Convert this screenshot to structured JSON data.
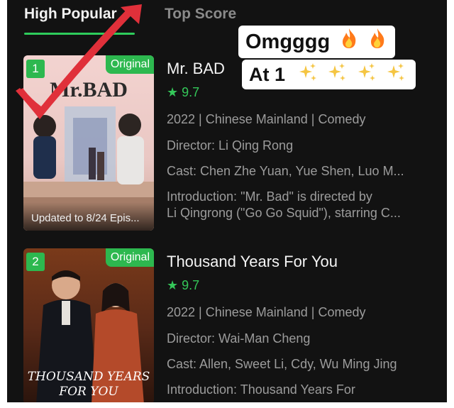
{
  "tabs": [
    {
      "label": "High Popular"
    },
    {
      "label": "Top Score"
    }
  ],
  "items": [
    {
      "rank": "1",
      "badge": "Original",
      "title": "Mr. BAD",
      "poster_text": "Mr.BAD",
      "rating": "9.7",
      "meta": "2022 | Chinese Mainland | Comedy",
      "director": "Director: Li Qing Rong",
      "cast": "Cast: Chen Zhe Yuan, Yue Shen, Luo M...",
      "intro_line1": "Introduction: \"Mr. Bad\" is directed by",
      "intro_line2": "Li Qingrong (\"Go Go Squid\"), starring C...",
      "update": "Updated to 8/24 Epis..."
    },
    {
      "rank": "2",
      "badge": "Original",
      "title": "Thousand Years For You",
      "poster_text_line1": "THOUSAND YEARS",
      "poster_text_line2": "FOR YOU",
      "rating": "9.7",
      "meta": "2022 | Chinese Mainland | Comedy",
      "director": "Director: Wai-Man Cheng",
      "cast": "Cast: Allen, Sweet Li, Cdy, Wu Ming Jing",
      "intro_line1": "Introduction: Thousand Years For"
    }
  ],
  "overlay": {
    "sticker1": "Omgggg",
    "sticker2": "At 1"
  },
  "icons": {
    "star": "star-icon",
    "fire": "fire-emoji",
    "sparkles": "sparkles-emoji",
    "check": "red-checkmark"
  },
  "colors": {
    "accent": "#2db84f",
    "rating": "#34c759",
    "background": "#121212",
    "check": "#e0303a"
  }
}
